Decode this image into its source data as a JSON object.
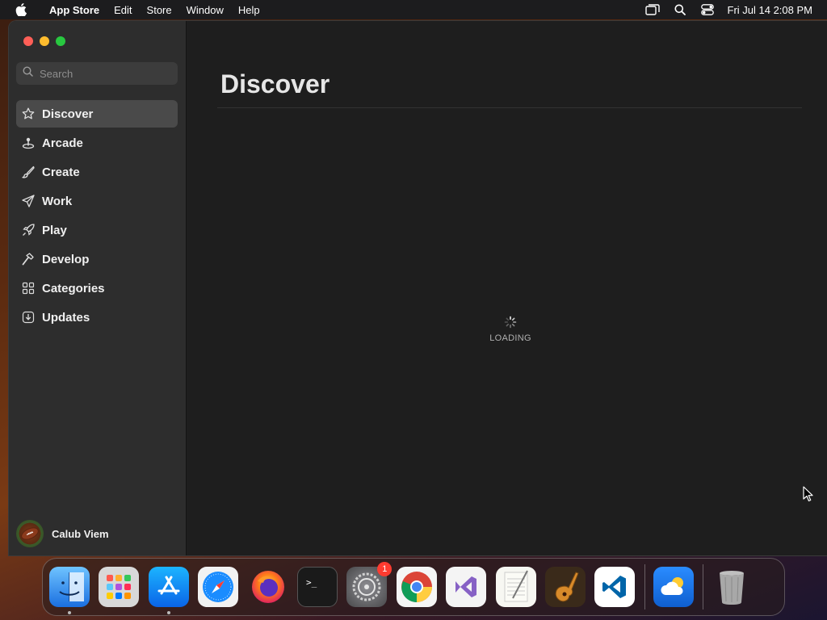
{
  "menubar": {
    "app_name": "App Store",
    "items": [
      "Edit",
      "Store",
      "Window",
      "Help"
    ],
    "clock": "Fri Jul 14  2:08 PM",
    "icons": [
      "apple-icon",
      "window-mirror-icon",
      "spotlight-search-icon",
      "control-center-icon"
    ]
  },
  "search": {
    "placeholder": "Search"
  },
  "sidebar": {
    "items": [
      {
        "label": "Discover",
        "icon": "star-icon",
        "active": true
      },
      {
        "label": "Arcade",
        "icon": "joystick-icon"
      },
      {
        "label": "Create",
        "icon": "paintbrush-icon"
      },
      {
        "label": "Work",
        "icon": "paperplane-icon"
      },
      {
        "label": "Play",
        "icon": "rocket-icon"
      },
      {
        "label": "Develop",
        "icon": "hammer-icon"
      },
      {
        "label": "Categories",
        "icon": "grid-icon"
      },
      {
        "label": "Updates",
        "icon": "download-icon"
      }
    ],
    "user_name": "Calub Viem"
  },
  "main": {
    "title": "Discover",
    "loading_text": "LOADING"
  },
  "dock": {
    "apps": [
      "Finder",
      "Launchpad",
      "App Store",
      "Safari",
      "Firefox",
      "Terminal",
      "System Settings",
      "Chrome",
      "Visual Studio",
      "TextEdit",
      "GarageBand",
      "VS Code",
      "Weather",
      "Trash"
    ],
    "system_settings_badge": "1"
  },
  "colors": {
    "accent_red": "#ff5f57",
    "accent_yellow": "#febc2e",
    "accent_green": "#28c840",
    "badge": "#ff3b30"
  }
}
